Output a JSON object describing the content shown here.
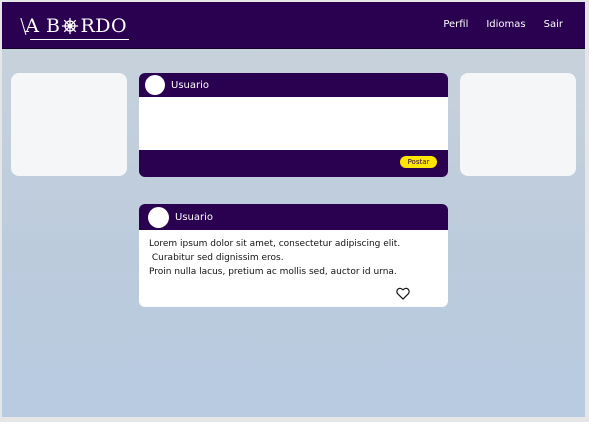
{
  "brand": {
    "logo_prefix": "A B",
    "logo_suffix": "RDO",
    "logo_text": "A BORDO"
  },
  "nav": {
    "items": [
      "Perfil",
      "Idiomas",
      "Sair"
    ]
  },
  "compose": {
    "username": "Usuario",
    "input_value": "",
    "post_label": "Postar"
  },
  "post": {
    "username": "Usuario",
    "lines": [
      "Lorem ipsum dolor sit amet, consectetur adipiscing elit.",
      " Curabitur sed dignissim eros.",
      "Proin nulla lacus, pretium ac mollis sed, auctor id urna."
    ]
  },
  "icons": {
    "logo_wheel": "ship-wheel-icon",
    "like": "heart-icon"
  },
  "colors": {
    "primary": "#2a0050",
    "accent": "#ffe500",
    "card": "#ffffff",
    "side_card": "#f4f6f8"
  }
}
